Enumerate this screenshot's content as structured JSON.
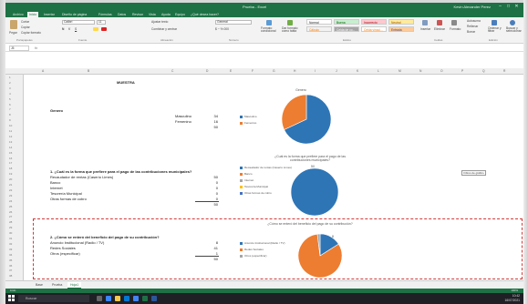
{
  "window": {
    "title": "Prueba - Excel",
    "user": "Kevin Alexander Perez",
    "controls": [
      "–",
      "□",
      "✕"
    ]
  },
  "ribbon_tabs": [
    "Archivo",
    "Inicio",
    "Insertar",
    "Diseño de página",
    "Fórmulas",
    "Datos",
    "Revisar",
    "Vista",
    "Ayuda",
    "Equipo",
    "¿Qué desea hacer?"
  ],
  "ribbon": {
    "clipboard": [
      "Cortar",
      "Copiar",
      "Copiar formato"
    ],
    "paste": "Pegar",
    "font_name": "Calibri",
    "font_size": "11",
    "wrap": "Ajustar texto",
    "merge": "Combinar y centrar",
    "number_format": "General",
    "conditional": "Formato condicional",
    "as_table": "Dar formato como tabla",
    "styles": [
      {
        "label": "Normal",
        "bg": "#ffffff",
        "fg": "#222222"
      },
      {
        "label": "Buena",
        "bg": "#c6efce",
        "fg": "#006100"
      },
      {
        "label": "Incorrecto",
        "bg": "#ffc7ce",
        "fg": "#9c0006"
      },
      {
        "label": "Neutral",
        "bg": "#ffeb9c",
        "fg": "#9c5700"
      },
      {
        "label": "Cálculo",
        "bg": "#f2f2f2",
        "fg": "#fa7d00"
      },
      {
        "label": "Celda de co...",
        "bg": "#a5a5a5",
        "fg": "#ffffff"
      },
      {
        "label": "Celda vincul...",
        "bg": "#ffffff",
        "fg": "#fa7d00"
      },
      {
        "label": "Entrada",
        "bg": "#ffcc99",
        "fg": "#3f3f76"
      }
    ],
    "insert": "Insertar",
    "delete": "Eliminar",
    "format": "Formato",
    "autosum": "Autosuma",
    "fill": "Rellenar",
    "clear": "Borrar",
    "sort": "Ordenar y filtrar",
    "find": "Buscar y seleccionar",
    "groups": [
      "Portapapeles",
      "Fuente",
      "Alineación",
      "Número",
      "Estilos",
      "Celdas",
      "Edición"
    ]
  },
  "formula_bar": {
    "name_box": "J5",
    "fx": "fx",
    "value": ""
  },
  "columns": [
    "A",
    "B",
    "C",
    "D",
    "E",
    "F",
    "G",
    "H",
    "I",
    "J",
    "K",
    "L",
    "M",
    "N",
    "O",
    "P",
    "Q",
    "R"
  ],
  "rows": [
    "1",
    "2",
    "3",
    "4",
    "5",
    "6",
    "7",
    "8",
    "9",
    "10",
    "11",
    "12",
    "13",
    "14",
    "15",
    "16",
    "17",
    "18",
    "19",
    "20",
    "21",
    "22",
    "23",
    "24",
    "25",
    "26",
    "27",
    "28",
    "29",
    "30",
    "31",
    "32",
    "33",
    "34",
    "35",
    "36",
    "37",
    "38"
  ],
  "sheet": {
    "header": "MUESTRA",
    "genero": {
      "label": "Genero",
      "rows": [
        {
          "label": "Masculino",
          "value": "34"
        },
        {
          "label": "Femenino",
          "value": "16"
        }
      ],
      "total": "50"
    },
    "q1": {
      "label": "1. ¿Cuál es la forma que prefiere para el pago de las contribuciones municipales?",
      "rows": [
        {
          "label": "Recaudador de rentas (Caserío Limes)",
          "value": "50"
        },
        {
          "label": "Banco",
          "value": "0"
        },
        {
          "label": "Internet",
          "value": "0"
        },
        {
          "label": "Tesorería Municipal",
          "value": "0"
        },
        {
          "label": "Otras formas de cobro",
          "value": "0"
        }
      ],
      "total": "50"
    },
    "q2": {
      "label": "2. ¿Cómo se enteró del beneficio del pago de su contribución?",
      "rows": [
        {
          "label": "Anuncio Institucional (Radio / TV)",
          "value": "8"
        },
        {
          "label": "Redes Sociales",
          "value": "41"
        },
        {
          "label": "Otros (especificar)",
          "value": "1"
        }
      ],
      "total": "50"
    }
  },
  "charts": {
    "colors": {
      "blue": "#2e75b6",
      "orange": "#ed7d31",
      "gray": "#a5a5a5"
    },
    "side_button": "Filtros de gráfico",
    "chart_data": [
      {
        "type": "pie",
        "title": "Genero",
        "categories": [
          "Masculino",
          "Femenino"
        ],
        "values": [
          34,
          16
        ],
        "legend": "left"
      },
      {
        "type": "pie",
        "title": "¿Cuál es la forma que prefiere para el pago de las contribuciones municipales?",
        "categories": [
          "Recaudador de rentas (Caserío Limes)",
          "Banco",
          "Internet",
          "Tesorería Municipal",
          "Otras formas de cobro"
        ],
        "values": [
          50,
          0,
          0,
          0,
          0
        ],
        "data_labels": [
          "50"
        ],
        "legend": "left"
      },
      {
        "type": "pie",
        "title": "¿Cómo se enteró del beneficio del pago de su contribución?",
        "categories": [
          "Anuncio Institucional (Radio / TV)",
          "Redes Sociales",
          "Otros (especificar)"
        ],
        "values": [
          8,
          41,
          1
        ],
        "data_labels": [
          "8"
        ],
        "legend": "left"
      }
    ]
  },
  "sheet_tabs": [
    "Base",
    "Prueba",
    "Hoja1"
  ],
  "active_sheet": "Hoja1",
  "status": {
    "left": "Listo",
    "zoom": "100%"
  },
  "taskbar": {
    "search_placeholder": "Buscar",
    "time": "10:42",
    "date": "16/07/2021"
  }
}
